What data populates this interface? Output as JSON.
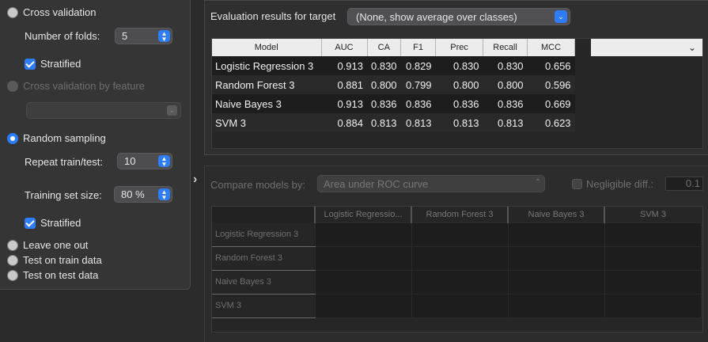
{
  "sampling": {
    "cross_validation": "Cross validation",
    "folds_label": "Number of folds:",
    "folds_value": "5",
    "stratified_1": "Stratified",
    "cv_by_feature": "Cross validation by feature",
    "random_sampling": "Random sampling",
    "repeat_label": "Repeat train/test:",
    "repeat_value": "10",
    "training_size_label": "Training set size:",
    "training_size_value": "80 %",
    "stratified_2": "Stratified",
    "leave_one_out": "Leave one out",
    "test_on_train": "Test on train data",
    "test_on_test": "Test on test data",
    "selected": "Random sampling"
  },
  "evaluation": {
    "target_label": "Evaluation results for target",
    "target_value": "(None, show average over classes)",
    "columns": [
      "Model",
      "AUC",
      "CA",
      "F1",
      "Prec",
      "Recall",
      "MCC"
    ],
    "rows": [
      [
        "Logistic Regression 3",
        "0.913",
        "0.830",
        "0.829",
        "0.830",
        "0.830",
        "0.656"
      ],
      [
        "Random Forest 3",
        "0.881",
        "0.800",
        "0.799",
        "0.800",
        "0.800",
        "0.596"
      ],
      [
        "Naive Bayes 3",
        "0.913",
        "0.836",
        "0.836",
        "0.836",
        "0.836",
        "0.669"
      ],
      [
        "SVM 3",
        "0.884",
        "0.813",
        "0.813",
        "0.813",
        "0.813",
        "0.623"
      ]
    ]
  },
  "compare": {
    "label": "Compare models by:",
    "metric": "Area under ROC curve",
    "negligible_label": "Negligible diff.:",
    "negligible_value": "0.1",
    "columns": [
      "Logistic Regressio...",
      "Random Forest 3",
      "Naive Bayes 3",
      "SVM 3"
    ],
    "rows": [
      "Logistic Regression 3",
      "Random Forest 3",
      "Naive Bayes 3",
      "SVM 3"
    ]
  },
  "colors": {
    "accent": "#2e7cf6",
    "background": "#2b2b2c"
  }
}
